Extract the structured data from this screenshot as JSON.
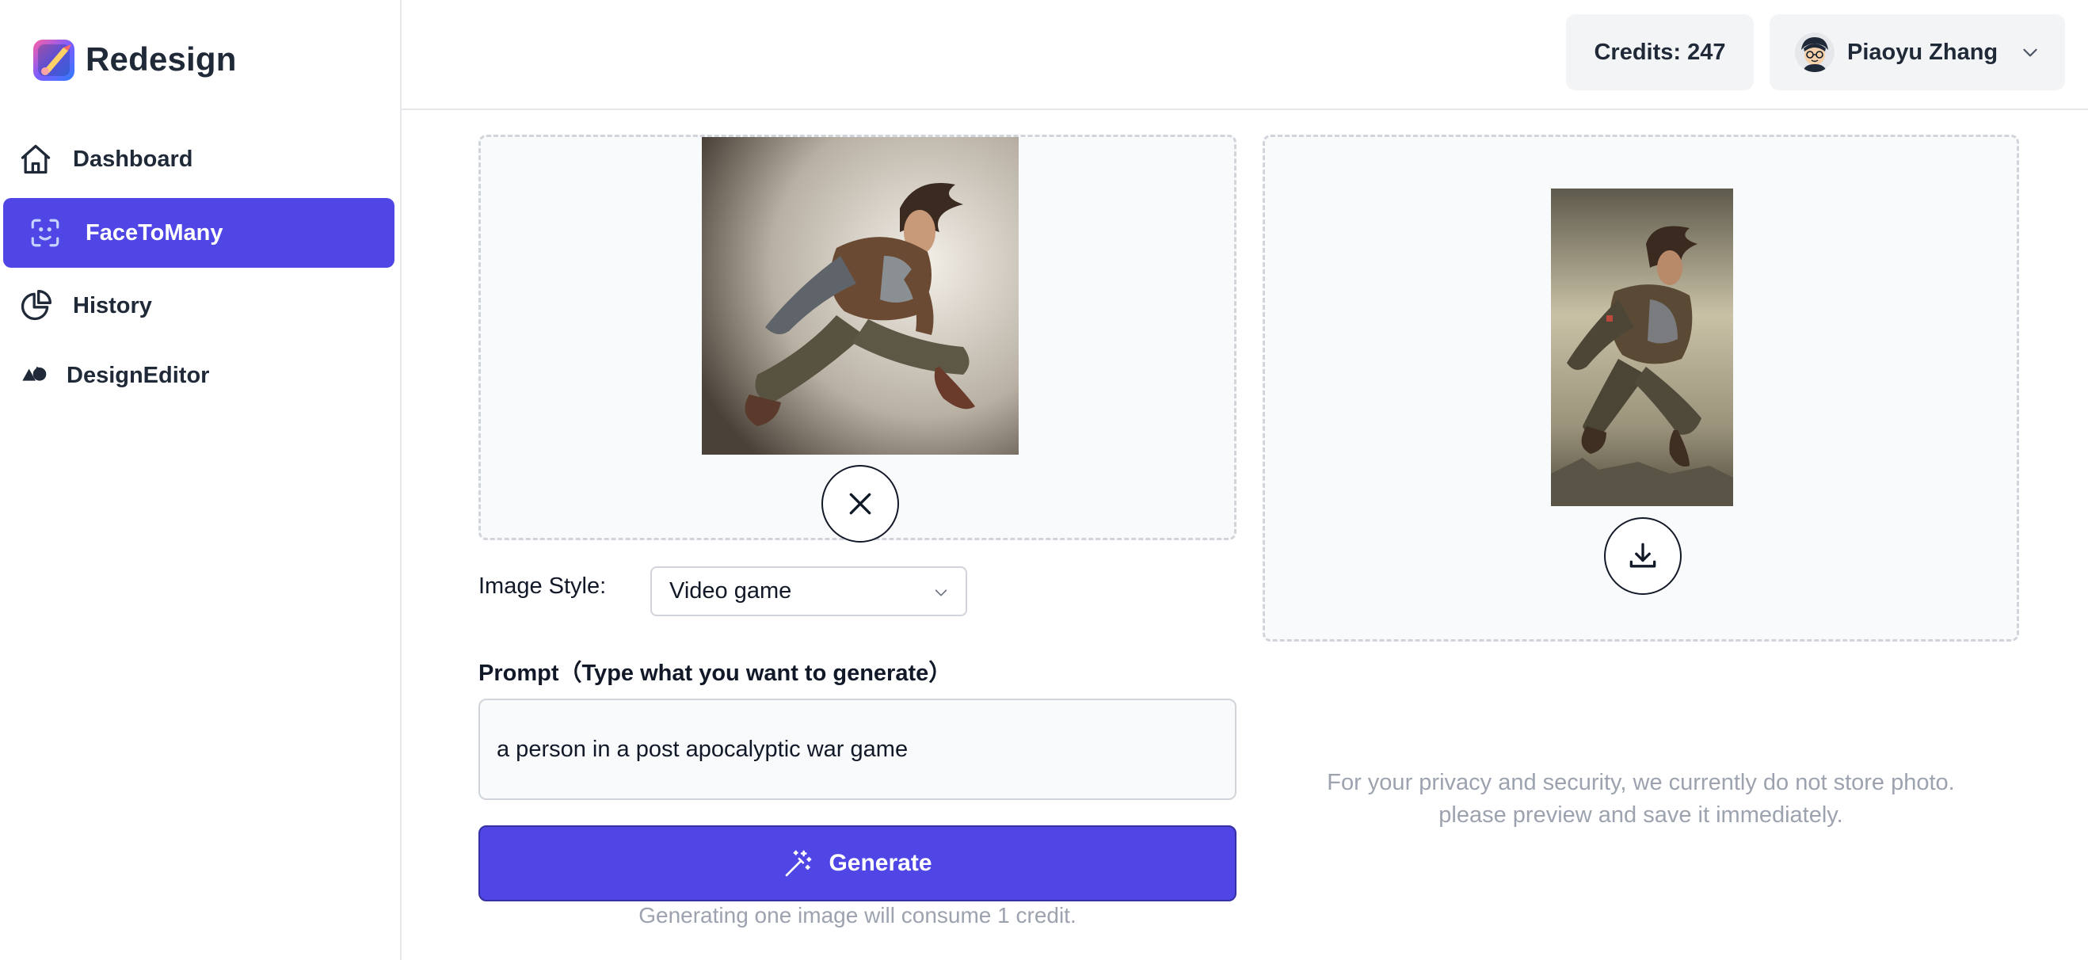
{
  "brand": {
    "name": "Redesign",
    "logo_icon": "paint-brush-logo-icon"
  },
  "sidebar": {
    "items": [
      {
        "label": "Dashboard",
        "icon": "home-icon",
        "active": false
      },
      {
        "label": "FaceToMany",
        "icon": "face-scan-icon",
        "active": true
      },
      {
        "label": "History",
        "icon": "pie-chart-icon",
        "active": false
      },
      {
        "label": "DesignEditor",
        "icon": "shapes-icon",
        "active": false
      }
    ]
  },
  "header": {
    "credits_label": "Credits: 247",
    "user_name": "Piaoyu Zhang",
    "user_menu_icon": "chevron-down-icon"
  },
  "upload": {
    "source_image_alt": "uploaded photo of person jumping",
    "remove_icon": "close-icon"
  },
  "result": {
    "result_image_alt": "generated video game style image",
    "download_icon": "download-icon",
    "privacy_note_line1": "For your privacy and security, we currently do not store photo.",
    "privacy_note_line2": "please preview and save it immediately."
  },
  "form": {
    "style_label": "Image Style:",
    "style_value": "Video game",
    "prompt_label": "Prompt（Type what you want to generate）",
    "prompt_value": "a person in a post apocalyptic war game",
    "generate_label": "Generate",
    "credit_note": "Generating one image will consume 1 credit."
  },
  "colors": {
    "accent": "#4f46e5",
    "muted_text": "#9ca3af",
    "border": "#d1d5db"
  }
}
